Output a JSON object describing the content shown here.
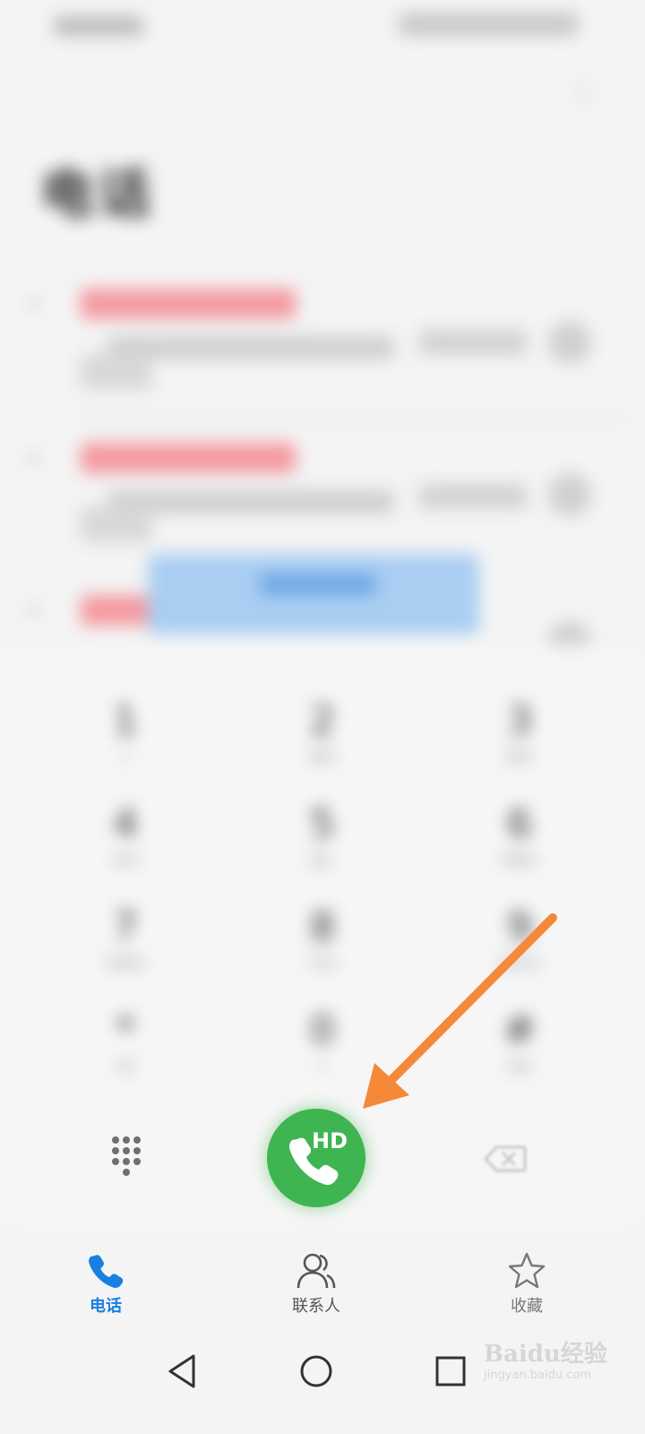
{
  "header": {
    "title": "电话"
  },
  "dialpad": {
    "keys": [
      {
        "digit": "1",
        "sub": "∞"
      },
      {
        "digit": "2",
        "sub": "ABC"
      },
      {
        "digit": "3",
        "sub": "DEF"
      },
      {
        "digit": "4",
        "sub": "GHI"
      },
      {
        "digit": "5",
        "sub": "JKL"
      },
      {
        "digit": "6",
        "sub": "MNO"
      },
      {
        "digit": "7",
        "sub": "PQRS"
      },
      {
        "digit": "8",
        "sub": "TUV"
      },
      {
        "digit": "9",
        "sub": "WXYZ"
      },
      {
        "digit": "*",
        "sub": "(P)"
      },
      {
        "digit": "0",
        "sub": "+"
      },
      {
        "digit": "#",
        "sub": "(W)"
      }
    ]
  },
  "call_button": {
    "badge": "HD",
    "color": "#3fb551"
  },
  "annotation": {
    "arrow_color": "#f5893a"
  },
  "bottom_nav": {
    "items": [
      {
        "label": "电话",
        "icon": "phone-icon",
        "active": true
      },
      {
        "label": "联系人",
        "icon": "contacts-icon",
        "active": false
      },
      {
        "label": "收藏",
        "icon": "star-icon",
        "active": false
      }
    ],
    "active_color": "#1a7fe0",
    "inactive_color": "#666666"
  },
  "watermark": {
    "brand": "Baidu经验",
    "url": "jingyan.baidu.com"
  }
}
